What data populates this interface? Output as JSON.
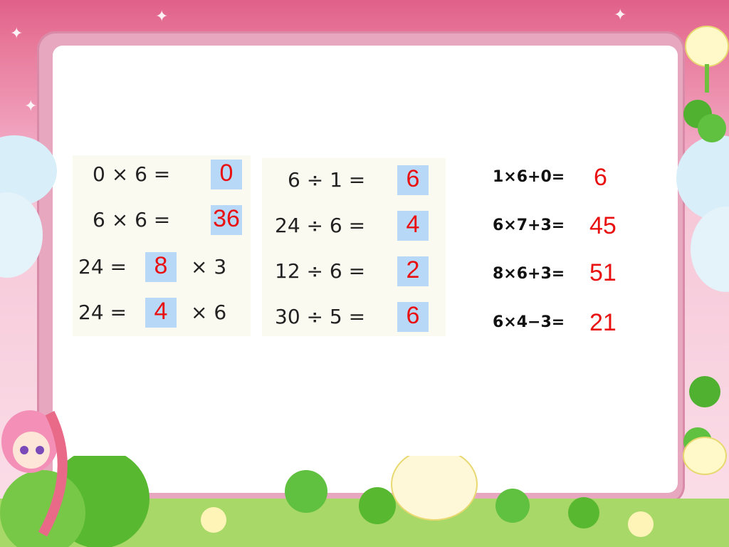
{
  "left_box": {
    "rows": [
      {
        "text": "0 × 6 =",
        "answer": "0"
      },
      {
        "text": "6 × 6 =",
        "answer": "36"
      },
      {
        "pre": "24 =",
        "answer": "8",
        "post": "× 3"
      },
      {
        "pre": "24 =",
        "answer": "4",
        "post": "× 6"
      }
    ]
  },
  "middle_box": {
    "rows": [
      {
        "text": "6 ÷ 1 =",
        "answer": "6"
      },
      {
        "text": "24 ÷ 6 =",
        "answer": "4"
      },
      {
        "text": "12 ÷ 6 =",
        "answer": "2"
      },
      {
        "text": "30 ÷ 5 =",
        "answer": "6"
      }
    ]
  },
  "right_list": {
    "rows": [
      {
        "text": "1×6+0=",
        "answer": "6"
      },
      {
        "text": "6×7+3=",
        "answer": "45"
      },
      {
        "text": "8×6+3=",
        "answer": "51"
      },
      {
        "text": "6×4−3=",
        "answer": "21"
      }
    ]
  },
  "colors": {
    "answer": "#e81010",
    "answer_cell": "#b8d8f8",
    "frame": "#e7a7bf"
  }
}
